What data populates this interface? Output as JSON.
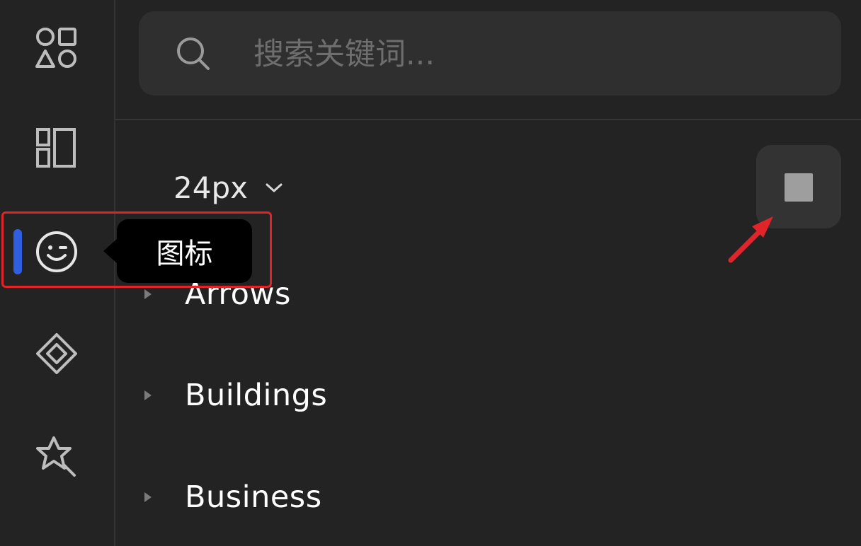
{
  "sidebar": {
    "items": [
      {
        "icon": "shapes-icon"
      },
      {
        "icon": "layout-columns-icon"
      },
      {
        "icon": "smiley-wink-icon",
        "active": true
      },
      {
        "icon": "component-diamond-icon"
      },
      {
        "icon": "magic-wand-star-icon"
      }
    ],
    "tooltip": "图标"
  },
  "search": {
    "placeholder": "搜索关键词...",
    "value": ""
  },
  "toolbar": {
    "size_label": "24px"
  },
  "categories": [
    {
      "label": "Arrows"
    },
    {
      "label": "Buildings"
    },
    {
      "label": "Business"
    }
  ],
  "colors": {
    "background": "#232323",
    "accent": "#2f5fe0",
    "annotation": "#e0242a"
  }
}
